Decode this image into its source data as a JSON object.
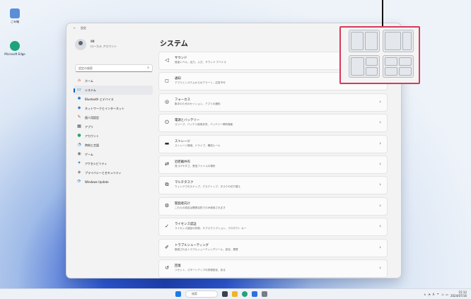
{
  "desktop": {
    "icons": [
      {
        "name": "recycle-bin",
        "label": "ごみ箱",
        "color": "#5a8fd8"
      },
      {
        "name": "edge",
        "label": "Microsoft Edge",
        "color": "#1fa37a"
      }
    ]
  },
  "window": {
    "back_glyph": "←",
    "title": "設定"
  },
  "profile": {
    "name": "ⅢⅢ",
    "account": "ローカル アカウント"
  },
  "search": {
    "placeholder": "設定の検索",
    "icon": "search-icon"
  },
  "nav": {
    "items": [
      {
        "icon": "home-icon",
        "glyph": "⌂",
        "color": "#d2542a",
        "label": "ホーム",
        "active": false
      },
      {
        "icon": "system-icon",
        "glyph": "▭",
        "color": "#0067c0",
        "label": "システム",
        "active": true
      },
      {
        "icon": "bluetooth-icon",
        "glyph": "✱",
        "color": "#0067c0",
        "label": "Bluetooth とデバイス",
        "active": false
      },
      {
        "icon": "network-icon",
        "glyph": "◆",
        "color": "#3b7dd8",
        "label": "ネットワークとインターネット",
        "active": false
      },
      {
        "icon": "personalization-icon",
        "glyph": "✎",
        "color": "#c24e23",
        "label": "個人用設定",
        "active": false
      },
      {
        "icon": "apps-icon",
        "glyph": "▦",
        "color": "#4a4f5a",
        "label": "アプリ",
        "active": false
      },
      {
        "icon": "accounts-icon",
        "glyph": "●",
        "color": "#27a36b",
        "label": "アカウント",
        "active": false
      },
      {
        "icon": "time-language-icon",
        "glyph": "◔",
        "color": "#1f7fd1",
        "label": "時刻と言語",
        "active": false
      },
      {
        "icon": "gaming-icon",
        "glyph": "◉",
        "color": "#6c7079",
        "label": "ゲーム",
        "active": false
      },
      {
        "icon": "accessibility-icon",
        "glyph": "✦",
        "color": "#1f6fd1",
        "label": "アクセシビリティ",
        "active": false
      },
      {
        "icon": "privacy-icon",
        "glyph": "◈",
        "color": "#6b6f78",
        "label": "プライバシーとセキュリティ",
        "active": false
      },
      {
        "icon": "windows-update-icon",
        "glyph": "⟳",
        "color": "#0e74d6",
        "label": "Windows Update",
        "active": false
      }
    ]
  },
  "main": {
    "title": "システム",
    "rows": [
      {
        "icon": "sound-icon",
        "glyph": "◁",
        "title": "サウンド",
        "desc": "音量レベル、出力、入力、サウンド デバイス"
      },
      {
        "icon": "notifications-icon",
        "glyph": "◻",
        "title": "通知",
        "desc": "アプリとシステムからのアラート、応答不可"
      },
      {
        "icon": "focus-icon",
        "glyph": "◎",
        "title": "フォーカス",
        "desc": "集中のためのセッション、アプリの通知"
      },
      {
        "icon": "power-icon",
        "glyph": "⏻",
        "title": "電源とバッテリー",
        "desc": "スリープ、バッテリ使用状況、バッテリー節約機能"
      },
      {
        "icon": "storage-icon",
        "glyph": "▬",
        "title": "ストレージ",
        "desc": "ストレージ領域、ドライブ、構成ルール"
      },
      {
        "icon": "nearby-sharing-icon",
        "glyph": "⇄",
        "title": "近距離共有",
        "desc": "見つけやすさ、受信ファイルの場所"
      },
      {
        "icon": "multitasking-icon",
        "glyph": "⧉",
        "title": "マルチタスク",
        "desc": "ウィンドウのスナップ、デスクトップ、タスクの切り替え"
      },
      {
        "icon": "developers-icon",
        "glyph": "⚙",
        "title": "開発者向け",
        "desc": "これらの設定は開発目的でのみ使用されます"
      },
      {
        "icon": "activation-icon",
        "glyph": "✓",
        "title": "ライセンス認証",
        "desc": "ライセンス認証の状態、サブスクリプション、プロダクト キー"
      },
      {
        "icon": "troubleshoot-icon",
        "glyph": "✐",
        "title": "トラブルシューティング",
        "desc": "推奨されるトラブルシューティングツール、設定、履歴"
      },
      {
        "icon": "recovery-icon",
        "glyph": "↺",
        "title": "回復",
        "desc": "リセット、スタートアップの詳細設定、戻る"
      }
    ]
  },
  "snap": {
    "accent": "#d63a5a",
    "layouts": [
      "two-equal",
      "wide-narrow",
      "two-and-stack",
      "grid-four"
    ]
  },
  "taskbar": {
    "search_label": "検索",
    "clock_time": "15:12",
    "clock_date": "2024/07/16",
    "tray_glyphs": [
      "∧",
      "◔",
      "A",
      "ᯤ",
      "◁",
      "▭"
    ]
  }
}
